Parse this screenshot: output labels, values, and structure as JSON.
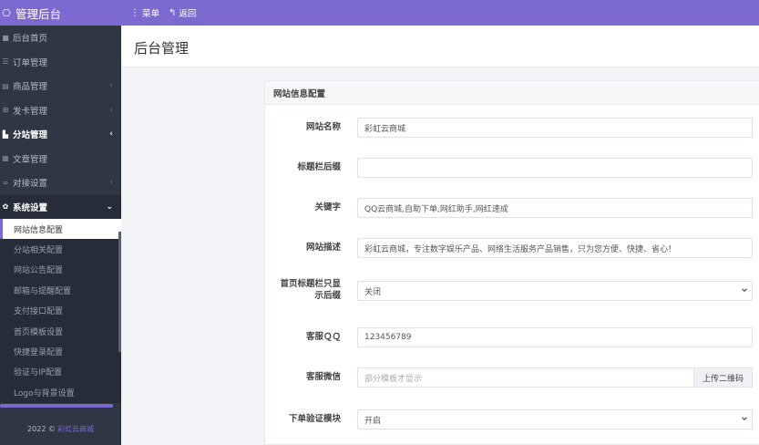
{
  "topbar": {
    "brand": "管理后台",
    "menu_label": "菜单",
    "back_label": "返回"
  },
  "sidebar": {
    "items": [
      {
        "label": "后台首页",
        "arrow": ""
      },
      {
        "label": "订单管理",
        "arrow": ""
      },
      {
        "label": "商品管理",
        "arrow": "‹"
      },
      {
        "label": "发卡管理",
        "arrow": "‹"
      },
      {
        "label": "分站管理",
        "arrow": "‹"
      },
      {
        "label": "文章管理",
        "arrow": ""
      },
      {
        "label": "对接设置",
        "arrow": "‹"
      },
      {
        "label": "系统设置",
        "arrow": "⌄"
      }
    ],
    "submenu": [
      "网站信息配置",
      "分站相关配置",
      "网站公告配置",
      "邮箱与提醒配置",
      "支付接口配置",
      "首页模板设置",
      "快捷登录配置",
      "验证与IP配置",
      "Logo与背景设置"
    ],
    "footer_year": "2022 ©",
    "footer_link": "彩虹云商城"
  },
  "page": {
    "title": "后台管理"
  },
  "panel": {
    "heading": "网站信息配置",
    "fields": {
      "site_name": {
        "label": "网站名称",
        "value": "彩虹云商城"
      },
      "title_suffix": {
        "label": "标题栏后缀",
        "value": ""
      },
      "keywords": {
        "label": "关键字",
        "value": "QQ云商城,自助下单,网红助手,网红速成"
      },
      "description": {
        "label": "网站描述",
        "value": "彩虹云商城，专注数字娱乐产品、网络生活服务产品销售，只为您方便、快捷、省心！"
      },
      "title_only_suffix": {
        "label_line1": "首页标题栏只显",
        "label_line2": "示后缀",
        "value": "关闭"
      },
      "service_qq": {
        "label": "客服ＱＱ",
        "value": "123456789"
      },
      "service_wechat": {
        "label": "客服微信",
        "placeholder": "部分模板才显示",
        "button": "上传二维码"
      },
      "order_verify": {
        "label": "下单验证模块",
        "value": "开启"
      }
    }
  }
}
